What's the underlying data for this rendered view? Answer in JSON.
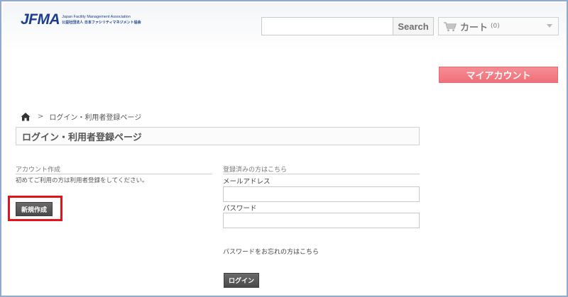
{
  "logo": {
    "mark": "JFMA",
    "english": "Japan Facility Management Association",
    "japanese": "公益社団法人 日本ファシリティマネジメント協会"
  },
  "search": {
    "placeholder": "",
    "button_label": "Search"
  },
  "cart": {
    "label": "カート",
    "count": "(0)"
  },
  "my_account_label": "マイアカウント",
  "breadcrumb": {
    "separator": ">",
    "current": "ログイン・利用者登録ページ"
  },
  "page_title": "ログイン・利用者登録ページ",
  "create_account": {
    "heading": "アカウント作成",
    "description": "初めてご利用の方は利用者登録をしてください。",
    "button_label": "新規作成"
  },
  "registered": {
    "heading": "登録済みの方はこちら",
    "email_label": "メールアドレス",
    "password_label": "パスワード",
    "forgot_link": "パスワードをお忘れの方はこちら",
    "login_label": "ログイン"
  },
  "colors": {
    "brand": "#1c3f8c",
    "accent": "#f26f78",
    "highlight": "#e3121b",
    "button_dark": "#4a4a4a"
  }
}
